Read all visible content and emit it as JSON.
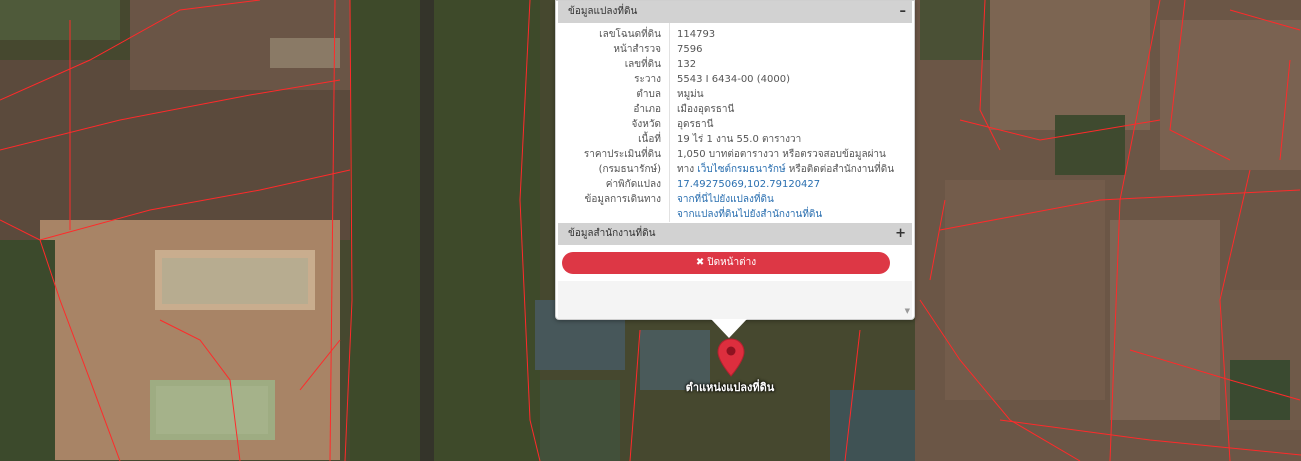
{
  "parcel_section": {
    "title": "ข้อมูลแปลงที่ดิน",
    "toggle": "–",
    "rows": [
      {
        "key": "เลขโฉนดที่ดิน",
        "value": "114793"
      },
      {
        "key": "หน้าสำรวจ",
        "value": "7596"
      },
      {
        "key": "เลขที่ดิน",
        "value": "132"
      },
      {
        "key": "ระวาง",
        "value": "5543 I 6434-00 (4000)"
      },
      {
        "key": "ตำบล",
        "value": "หมูม่น"
      },
      {
        "key": "อำเภอ",
        "value": "เมืองอุดรธานี"
      },
      {
        "key": "จังหวัด",
        "value": "อุดรธานี"
      },
      {
        "key": "เนื้อที่",
        "value": "19 ไร่ 1 งาน 55.0 ตารางวา"
      }
    ],
    "price": {
      "key_line1": "ราคาประเมินที่ดิน",
      "key_line2": "(กรมธนารักษ์)",
      "value_line1": "1,050 บาทต่อตารางวา หรือตรวจสอบข้อมูลผ่าน",
      "value_line2_pre": "ทาง ",
      "value_line2_link": "เว็บไซต์กรมธนารักษ์",
      "value_line2_post": " หรือติดต่อสำนักงานที่ดิน"
    },
    "coords": {
      "key": "ค่าพิกัดแปลง",
      "value": "17.49275069,102.79120427"
    },
    "travel": {
      "key": "ข้อมูลการเดินทาง",
      "link1": "จากที่นี่ไปยังแปลงที่ดิน",
      "link2": "จากแปลงที่ดินไปยังสำนักงานที่ดิน"
    }
  },
  "office_section": {
    "title": "ข้อมูลสำนักงานที่ดิน",
    "toggle": "+"
  },
  "close_button": {
    "icon": "✖",
    "label": "ปิดหน้าต่าง"
  },
  "scroll_arrow": "▼",
  "marker": {
    "label": "ตำแหน่งแปลงที่ดิน",
    "color": "#dd2e3e"
  },
  "colors": {
    "boundary_lines": "#ff2a2a",
    "close_button": "#dd3745",
    "link": "#2a6fb0"
  }
}
